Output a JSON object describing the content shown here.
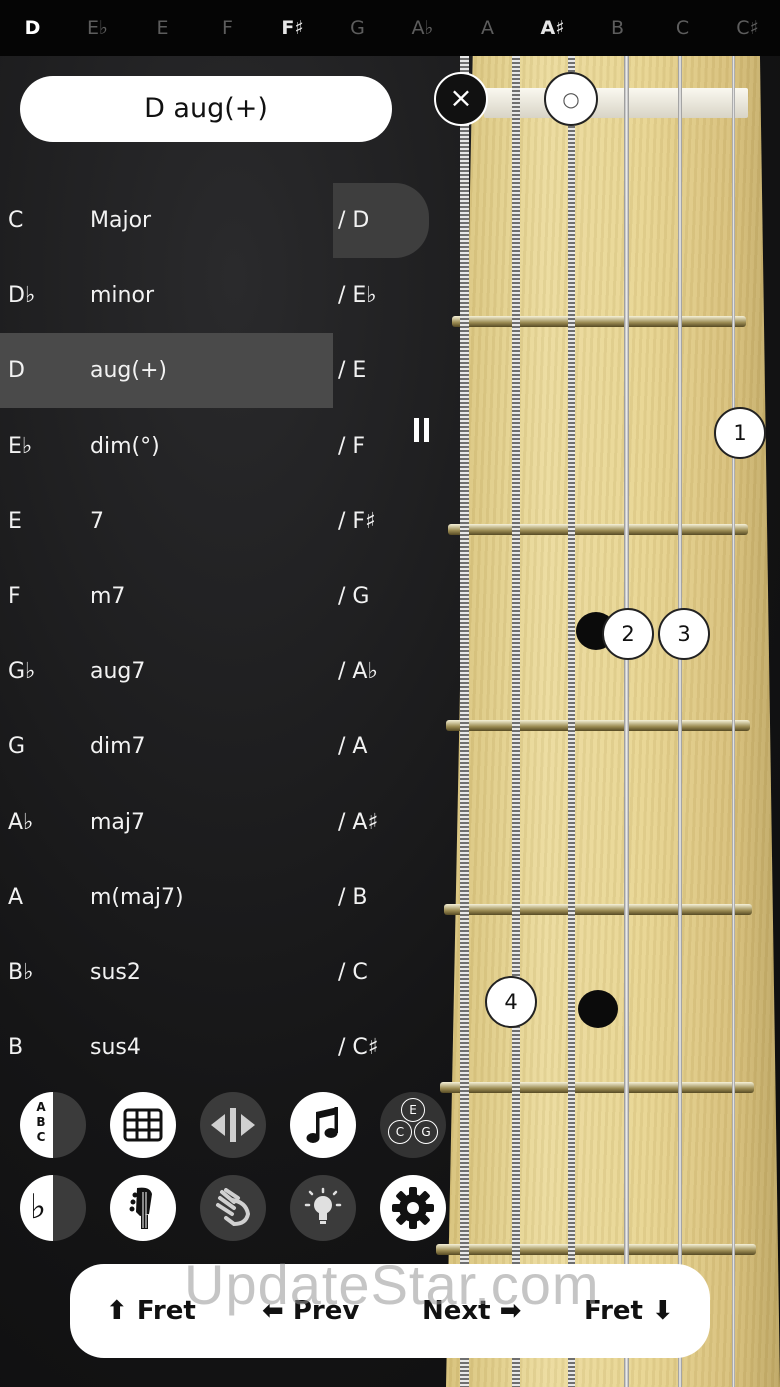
{
  "top_notes": [
    {
      "label": "D",
      "style": "bold"
    },
    {
      "label": "E♭",
      "style": "dim"
    },
    {
      "label": "E",
      "style": "dim"
    },
    {
      "label": "F",
      "style": "dim"
    },
    {
      "label": "F♯",
      "style": "mid"
    },
    {
      "label": "G",
      "style": "dim"
    },
    {
      "label": "A♭",
      "style": "dim"
    },
    {
      "label": "A",
      "style": "dim"
    },
    {
      "label": "A♯",
      "style": "mid"
    },
    {
      "label": "B",
      "style": "dim"
    },
    {
      "label": "C",
      "style": "dim"
    },
    {
      "label": "C♯",
      "style": "dim"
    }
  ],
  "chord_title": "D aug(+)",
  "roots": [
    "C",
    "D♭",
    "D",
    "E♭",
    "E",
    "F",
    "G♭",
    "G",
    "A♭",
    "A",
    "B♭",
    "B"
  ],
  "qualities": [
    "Major",
    "minor",
    "aug(+)",
    "dim(°)",
    "7",
    "m7",
    "aug7",
    "dim7",
    "maj7",
    "m(maj7)",
    "sus2",
    "sus4"
  ],
  "bass_notes": [
    "/ D",
    "/ E♭",
    "/ E",
    "/ F",
    "/ F♯",
    "/ G",
    "/ A♭",
    "/ A",
    "/ A♯",
    "/ B",
    "/ C",
    "/ C♯"
  ],
  "selected": {
    "root": "D",
    "quality": "aug(+)",
    "bass": "/ D"
  },
  "fretboard": {
    "close_symbol": "×",
    "open_symbol": "○",
    "fingers": [
      "1",
      "2",
      "3",
      "4"
    ]
  },
  "tools": {
    "abc_letters": [
      "A",
      "B",
      "C"
    ],
    "chord_circle_notes": [
      "E",
      "C",
      "G"
    ],
    "flat_symbol": "♭"
  },
  "nav": {
    "fret_up": "⬆ Fret",
    "prev": "⬅ Prev",
    "next": "Next ➡",
    "fret_down": "Fret ⬇"
  },
  "watermark": "UpdateStar.com"
}
